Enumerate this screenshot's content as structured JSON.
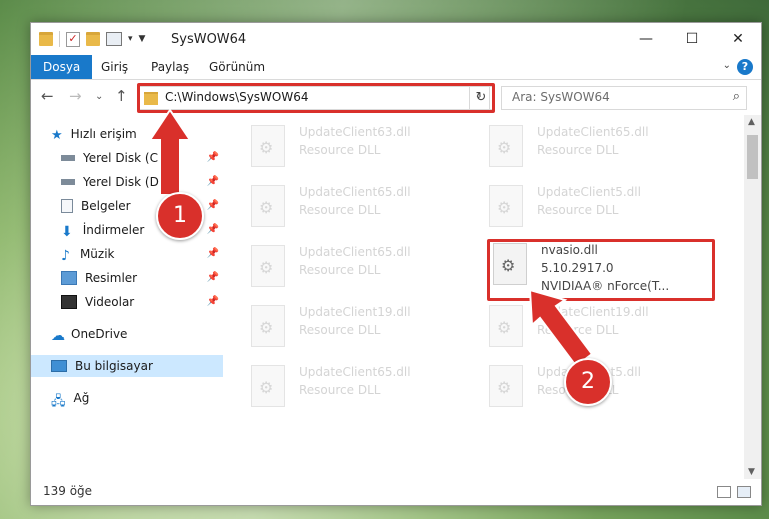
{
  "window": {
    "title": "SysWOW64"
  },
  "ribbon": {
    "tabs": [
      "Dosya",
      "Giriş",
      "Paylaş",
      "Görünüm"
    ]
  },
  "navigation": {
    "address": "C:\\Windows\\SysWOW64",
    "search_placeholder": "Ara: SysWOW64"
  },
  "sidebar": {
    "items": [
      {
        "label": "Hızlı erişim",
        "icon": "star-icon"
      },
      {
        "label": "Yerel Disk (C:)",
        "icon": "drive-icon",
        "pinned": true
      },
      {
        "label": "Yerel Disk (D:)",
        "icon": "drive-icon",
        "pinned": true
      },
      {
        "label": "Belgeler",
        "icon": "documents-icon",
        "pinned": true
      },
      {
        "label": "İndirmeler",
        "icon": "download-icon",
        "pinned": true
      },
      {
        "label": "Müzik",
        "icon": "music-icon",
        "pinned": true
      },
      {
        "label": "Resimler",
        "icon": "pictures-icon",
        "pinned": true
      },
      {
        "label": "Videolar",
        "icon": "videos-icon",
        "pinned": true
      },
      {
        "label": "OneDrive",
        "icon": "cloud-icon"
      },
      {
        "label": "Bu bilgisayar",
        "icon": "computer-icon",
        "selected": true
      },
      {
        "label": "Ağ",
        "icon": "network-icon"
      }
    ]
  },
  "files": [
    {
      "name": "UpdateClient63.dll",
      "desc": "Resource DLL"
    },
    {
      "name": "UpdateClient65.dll",
      "desc": "Resource DLL"
    },
    {
      "name": "UpdateClient65.dll",
      "desc": "Resource DLL"
    },
    {
      "name": "UpdateClient5.dll",
      "desc": "Resource DLL"
    },
    {
      "name": "UpdateClient65.dll",
      "desc": "Resource DLL"
    },
    {
      "name": "nvasio.dll",
      "version": "5.10.2917.0",
      "desc": "NVIDIAA® nForce(T..."
    },
    {
      "name": "UpdateClient19.dll",
      "desc": "Resource DLL"
    },
    {
      "name": "UpdateClient19.dll",
      "desc": "Resource DLL"
    },
    {
      "name": "UpdateClient65.dll",
      "desc": "Resource DLL"
    },
    {
      "name": "UpdateClient5.dll",
      "desc": "Resource DLL"
    }
  ],
  "status": {
    "count": "139 öğe"
  },
  "annotations": {
    "step1": "1",
    "step2": "2"
  },
  "colors": {
    "highlight": "#d9302b",
    "accent": "#1979ca",
    "selected": "#cce8ff"
  }
}
